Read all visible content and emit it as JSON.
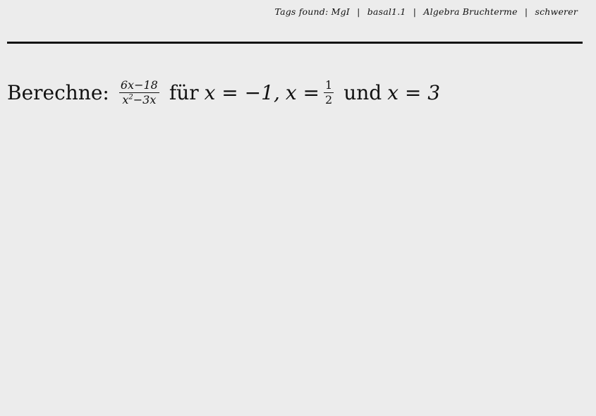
{
  "header": {
    "tags_label": "Tags found:",
    "tags": [
      "MgI",
      "basal1.1",
      "Algebra Bruchterme",
      "schwerer"
    ]
  },
  "task": {
    "prefix": "Berechne:",
    "fraction": {
      "numerator": "6x−18",
      "denominator_base": "x",
      "denominator_exp": "2",
      "denominator_rest": "−3x"
    },
    "for_word": "für",
    "val1": "x = −1,",
    "val2_lhs": "x =",
    "val2_frac": {
      "numerator": "1",
      "denominator": "2"
    },
    "and_word": "und",
    "val3": "x = 3"
  }
}
